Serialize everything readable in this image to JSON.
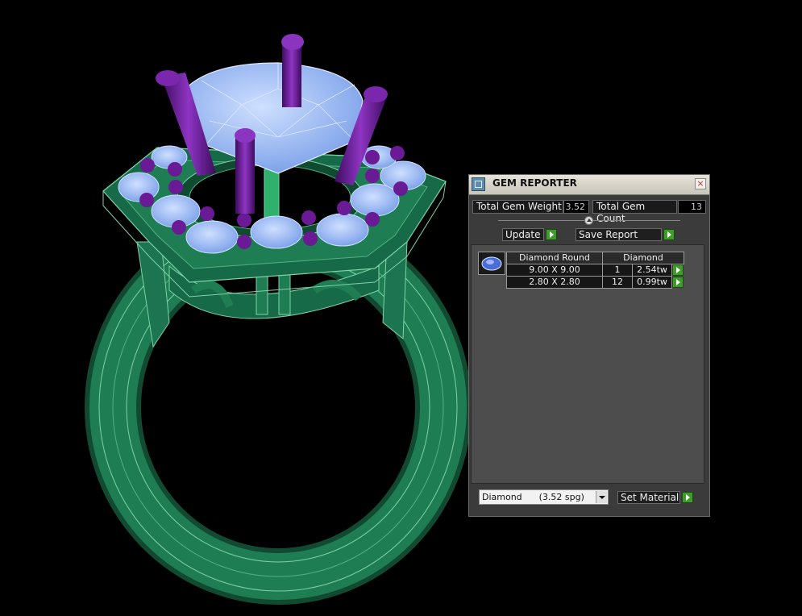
{
  "panel": {
    "title": "GEM REPORTER",
    "close_glyph": "×",
    "total_weight_label": "Total Gem Weight",
    "total_weight_value": "3.52",
    "total_count_label": "Total Gem Count",
    "total_count_value": "13",
    "update_label": "Update",
    "save_report_label": "Save Report",
    "table": {
      "headers": [
        "Diamond Round",
        "Diamond"
      ],
      "rows": [
        {
          "size": "9.00 X 9.00",
          "count": "1",
          "weight": "2.54tw"
        },
        {
          "size": "2.80 X 2.80",
          "count": "12",
          "weight": "0.99tw"
        }
      ]
    },
    "material_select_value": "Diamond      (3.52 spg)",
    "set_material_label": "Set Material"
  },
  "colors": {
    "metal": "#1e7a52",
    "gem": "#8fb4f4",
    "prong": "#6a1a94",
    "go_button": "#3f9b2a"
  }
}
